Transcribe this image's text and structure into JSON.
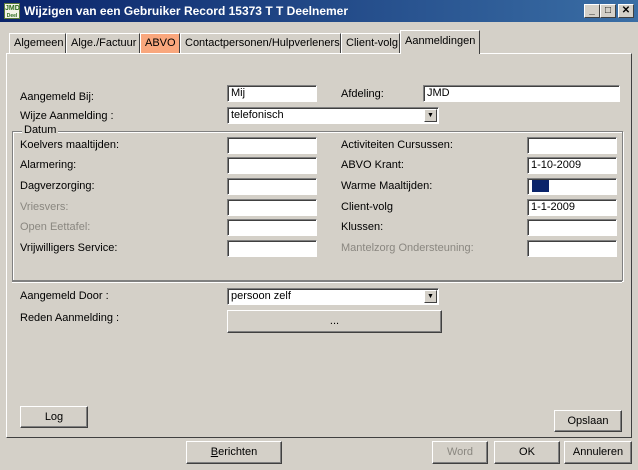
{
  "window": {
    "app_icon_text_top": "JMD",
    "app_icon_text_bottom": "Deel",
    "title": "Wijzigen van een Gebruiker Record 15373  T T Deelnemer",
    "minimize": "_",
    "maximize": "□",
    "close": "✕"
  },
  "tabs": [
    {
      "label": "Algemeen"
    },
    {
      "label": "Alge./Factuur"
    },
    {
      "label": "ABVO"
    },
    {
      "label": "Contactpersonen/Hulpverleners"
    },
    {
      "label": "Client-volg"
    },
    {
      "label": "Aanmeldingen"
    }
  ],
  "form": {
    "aangemeld_bij_label": "Aangemeld Bij:",
    "aangemeld_bij_value": "Mij",
    "afdeling_label": "Afdeling:",
    "afdeling_value": "JMD",
    "wijze_label": "Wijze Aanmelding :",
    "wijze_value": "telefonisch",
    "datum_group_label": "Datum",
    "left_fields": [
      {
        "label": "Koelvers maaltijden:",
        "value": "",
        "disabled": false
      },
      {
        "label": "Alarmering:",
        "value": "",
        "disabled": false
      },
      {
        "label": "Dagverzorging:",
        "value": "",
        "disabled": false
      },
      {
        "label": "Vriesvers:",
        "value": "",
        "disabled": true
      },
      {
        "label": "Open Eettafel:",
        "value": "",
        "disabled": true
      },
      {
        "label": "Vrijwilligers Service:",
        "value": "",
        "disabled": false
      }
    ],
    "right_fields": [
      {
        "label": "Activiteiten Cursussen:",
        "value": "",
        "disabled": false
      },
      {
        "label": "ABVO Krant:",
        "value": "1-10-2009",
        "disabled": false
      },
      {
        "label": "Warme Maaltijden:",
        "value": "",
        "disabled": false
      },
      {
        "label": "Client-volg",
        "value": "1-1-2009",
        "disabled": false
      },
      {
        "label": "Klussen:",
        "value": "",
        "disabled": false
      },
      {
        "label": "Mantelzorg Ondersteuning:",
        "value": "",
        "disabled": true
      }
    ],
    "aangemeld_door_label": "Aangemeld Door :",
    "aangemeld_door_value": "persoon zelf",
    "reden_label": "Reden Aanmelding :",
    "reden_button": "..."
  },
  "buttons": {
    "log": "Log",
    "opslaan": "Opslaan",
    "berichten": "Berichten",
    "word": "Word",
    "ok": "OK",
    "annuleren": "Annuleren"
  },
  "colors": {
    "titlebar_start": "#0a246a",
    "titlebar_end": "#3a6ea5",
    "face": "#d4d0c8",
    "highlight_tab": "#f9a77d",
    "selection": "#0a246a"
  }
}
